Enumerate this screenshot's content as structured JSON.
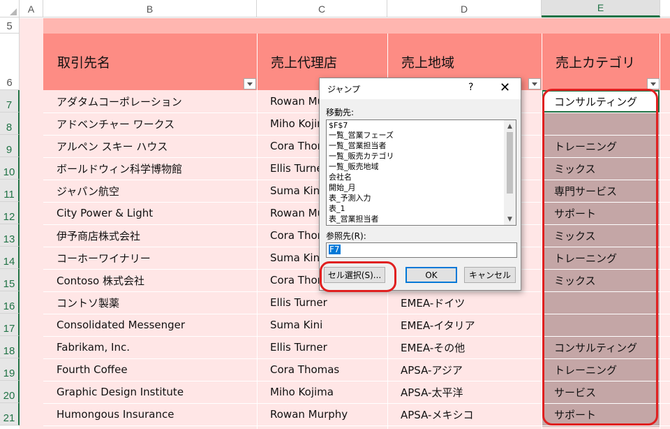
{
  "columns": [
    "A",
    "B",
    "C",
    "D",
    "E"
  ],
  "row_numbers": [
    "5",
    "6",
    "7",
    "8",
    "9",
    "10",
    "11",
    "12",
    "13",
    "14",
    "15",
    "16",
    "17",
    "18",
    "19",
    "20",
    "21"
  ],
  "table": {
    "headers": [
      "取引先名",
      "売上代理店",
      "売上地域",
      "売上カテゴリ"
    ],
    "rows": [
      {
        "name": "アダタムコーポレーション",
        "agent": "Rowan Mu",
        "region": "",
        "category": "コンサルティング"
      },
      {
        "name": "アドベンチャー ワークス",
        "agent": "Miho Kojin",
        "region": "",
        "category": ""
      },
      {
        "name": "アルペン スキー ハウス",
        "agent": "Cora Thor",
        "region": "",
        "category": "トレーニング"
      },
      {
        "name": "ボールドウィン科学博物館",
        "agent": "Ellis Turne",
        "region": "",
        "category": "ミックス"
      },
      {
        "name": "ジャパン航空",
        "agent": "Suma Kini",
        "region": "",
        "category": "専門サービス"
      },
      {
        "name": "City Power & Light",
        "agent": "Rowan Mu",
        "region": "",
        "category": "サポート"
      },
      {
        "name": "伊予商店株式会社",
        "agent": "Cora Thor",
        "region": "",
        "category": "ミックス"
      },
      {
        "name": "コーホーワイナリー",
        "agent": "Suma Kini",
        "region": "",
        "category": "トレーニング"
      },
      {
        "name": "Contoso 株式会社",
        "agent": "Cora Thor",
        "region": "",
        "category": "ミックス"
      },
      {
        "name": "コントソ製薬",
        "agent": "Ellis Turner",
        "region": "EMEA-ドイツ",
        "category": ""
      },
      {
        "name": "Consolidated Messenger",
        "agent": "Suma Kini",
        "region": "EMEA-イタリア",
        "category": ""
      },
      {
        "name": "Fabrikam, Inc.",
        "agent": "Ellis Turner",
        "region": "EMEA-その他",
        "category": "コンサルティング"
      },
      {
        "name": "Fourth Coffee",
        "agent": "Cora Thomas",
        "region": "APSA-アジア",
        "category": "トレーニング"
      },
      {
        "name": "Graphic Design Institute",
        "agent": "Miho Kojima",
        "region": "APSA-太平洋",
        "category": "サービス"
      },
      {
        "name": "Humongous Insurance",
        "agent": "Rowan Murphy",
        "region": "APSA-メキシコ",
        "category": "サポート"
      }
    ]
  },
  "dialog": {
    "title": "ジャンプ",
    "help": "?",
    "close": "✕",
    "goto_label": "移動先:",
    "list_items": [
      "$F$7",
      "一覧_営業フェーズ",
      "一覧_営業担当者",
      "一覧_販売カテゴリ",
      "一覧_販売地域",
      "会社名",
      "開始_月",
      "表_予測入力",
      "表_1",
      "表_営業担当者"
    ],
    "reference_label": "参照先(R):",
    "reference_value": "F7",
    "special_button": "セル選択(S)...",
    "ok_button": "OK",
    "cancel_button": "キャンセル"
  },
  "colors": {
    "header_fill": "#fd8c84",
    "row_fill": "#ffe6e6",
    "highlight": "#e02020",
    "selection_gray": "#c4a6a6"
  }
}
